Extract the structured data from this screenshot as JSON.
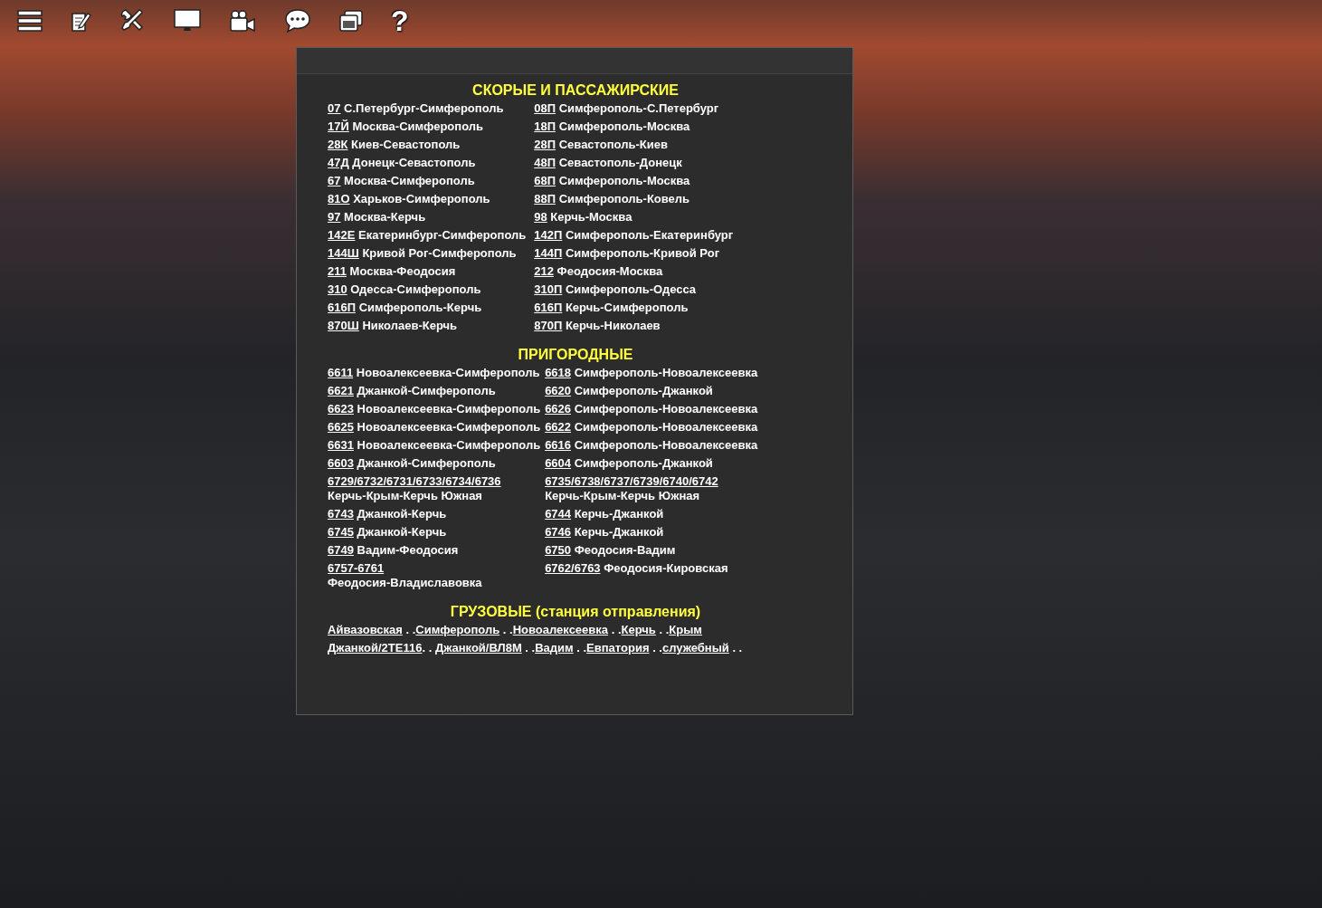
{
  "toolbar": {
    "help_glyph": "?"
  },
  "sections": [
    {
      "title": "СКОРЫЕ И ПАССАЖИРСКИЕ",
      "entries": [
        {
          "number": "07",
          "route": "С.Петербург-Симферополь",
          "kind": "inline"
        },
        {
          "number": "08П",
          "route": "Симферополь-С.Петербург",
          "kind": "inline"
        },
        {
          "number": "17Й",
          "route": "Москва-Симферополь",
          "kind": "inline"
        },
        {
          "number": "18П",
          "route": "Симферополь-Москва",
          "kind": "inline"
        },
        {
          "number": "28К",
          "route": "Киев-Севастополь",
          "kind": "inline"
        },
        {
          "number": "28П",
          "route": "Севастополь-Киев",
          "kind": "inline"
        },
        {
          "number": "47Д",
          "route": "Донецк-Севастополь",
          "kind": "inline"
        },
        {
          "number": "48П",
          "route": "Севастополь-Донецк",
          "kind": "inline"
        },
        {
          "number": "67",
          "route": "Москва-Симферополь",
          "kind": "inline"
        },
        {
          "number": "68П",
          "route": "Симферополь-Москва",
          "kind": "inline"
        },
        {
          "number": "81О",
          "route": "Харьков-Симферополь",
          "kind": "inline"
        },
        {
          "number": "88П",
          "route": "Симферополь-Ковель",
          "kind": "inline"
        },
        {
          "number": "97",
          "route": "Москва-Керчь",
          "kind": "inline"
        },
        {
          "number": "98",
          "route": "Керчь-Москва",
          "kind": "inline"
        },
        {
          "number": "142Е",
          "route": "Екатеринбург-Симферополь",
          "kind": "inline"
        },
        {
          "number": "142П",
          "route": "Симферополь-Екатеринбург",
          "kind": "inline"
        },
        {
          "number": "144Ш",
          "route": "Кривой Рог-Симферополь",
          "kind": "inline"
        },
        {
          "number": "144П",
          "route": "Симферополь-Кривой Рог",
          "kind": "inline"
        },
        {
          "number": "211",
          "route": "Москва-Феодосия",
          "kind": "inline"
        },
        {
          "number": "212",
          "route": "Феодосия-Москва",
          "kind": "inline"
        },
        {
          "number": "310",
          "route": "Одесса-Симферополь",
          "kind": "inline"
        },
        {
          "number": "310П",
          "route": "Симферополь-Одесса",
          "kind": "inline"
        },
        {
          "number": "616П",
          "route": "Симферополь-Керчь",
          "kind": "inline"
        },
        {
          "number": "616П",
          "route": "Керчь-Симферополь",
          "kind": "inline"
        },
        {
          "number": "870Ш",
          "route": "Николаев-Керчь",
          "kind": "inline"
        },
        {
          "number": "870П",
          "route": "Керчь-Николаев",
          "kind": "inline"
        }
      ]
    },
    {
      "title": "ПРИГОРОДНЫЕ",
      "entries": [
        {
          "number": "6611",
          "route": "Новоалексеевка-Симферополь",
          "kind": "inline"
        },
        {
          "number": "6618",
          "route": "Симферополь-Новоалексеевка",
          "kind": "inline"
        },
        {
          "number": "6621",
          "route": "Джанкой-Симферополь",
          "kind": "inline"
        },
        {
          "number": "6620",
          "route": "Симферополь-Джанкой",
          "kind": "inline"
        },
        {
          "number": "6623",
          "route": "Новоалексеевка-Симферополь",
          "kind": "inline"
        },
        {
          "number": "6626",
          "route": "Симферополь-Новоалексеевка",
          "kind": "inline"
        },
        {
          "number": "6625",
          "route": "Новоалексеевка-Симферополь",
          "kind": "inline"
        },
        {
          "number": "6622",
          "route": "Симферополь-Новоалексеевка",
          "kind": "inline"
        },
        {
          "number": "6631",
          "route": "Новоалексеевка-Симферополь",
          "kind": "inline"
        },
        {
          "number": "6616",
          "route": "Симферополь-Новоалексеевка",
          "kind": "inline"
        },
        {
          "number": "6603",
          "route": "Джанкой-Симферополь",
          "kind": "inline"
        },
        {
          "number": "6604",
          "route": "Симферополь-Джанкой",
          "kind": "inline"
        },
        {
          "number": "6729/6732/6731/6733/6734/6736",
          "route": "Керчь-Крым-Керчь Южная",
          "kind": "wrapped"
        },
        {
          "number": "6735/6738/6737/6739/6740/6742",
          "route": "Керчь-Крым-Керчь Южная",
          "kind": "wrapped"
        },
        {
          "number": "6743",
          "route": "Джанкой-Керчь",
          "kind": "inline"
        },
        {
          "number": "6744",
          "route": "Керчь-Джанкой",
          "kind": "inline"
        },
        {
          "number": "6745",
          "route": "Джанкой-Керчь",
          "kind": "inline"
        },
        {
          "number": "6746",
          "route": "Керчь-Джанкой",
          "kind": "inline"
        },
        {
          "number": "6749",
          "route": "Вадим-Феодосия",
          "kind": "inline"
        },
        {
          "number": "6750",
          "route": "Феодосия-Вадим",
          "kind": "inline"
        },
        {
          "number": "6757-6761",
          "route": "Феодосия-Владиславовка",
          "kind": "wrapped"
        },
        {
          "number": "6762/6763",
          "route": "Феодосия-Кировская",
          "kind": "inline"
        }
      ]
    }
  ],
  "freight": {
    "title": "ГРУЗОВЫЕ (станция отправления)",
    "lines": [
      [
        {
          "station": "Айвазовская",
          "after": " . ."
        },
        {
          "station": "Симферополь",
          "after": " . ."
        },
        {
          "station": "Новоалексеевка",
          "after": " . ."
        },
        {
          "station": "Керчь",
          "after": " . ."
        },
        {
          "station": "Крым"
        }
      ],
      [
        {
          "station": "Джанкой/2TE116",
          "after": ". . "
        },
        {
          "station": "Джанкой/ВЛ8М",
          "after": " . ."
        },
        {
          "station": "Вадим",
          "after": " . ."
        },
        {
          "station": "Евпатория",
          "after": " . ."
        },
        {
          "station": "служебный",
          "after": " . ."
        }
      ]
    ]
  }
}
